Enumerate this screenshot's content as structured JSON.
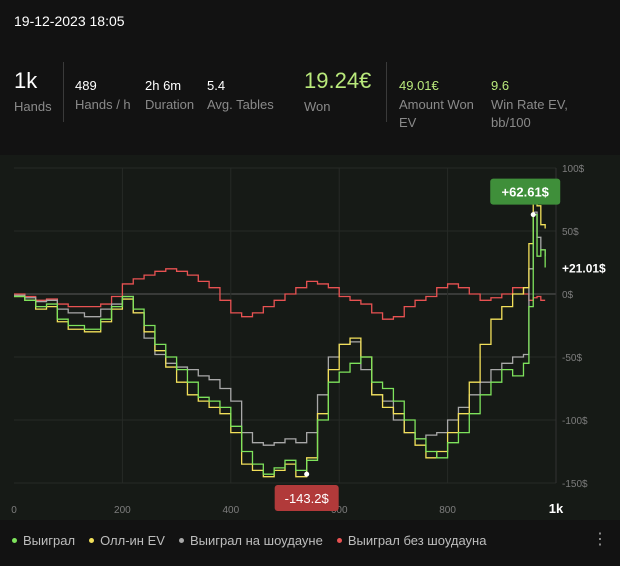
{
  "header": {
    "date": "19-12-2023 18:05"
  },
  "stats": {
    "hands": {
      "value": "1k",
      "label": "Hands"
    },
    "hands_per_hour": {
      "value": "489",
      "label": "Hands / h"
    },
    "duration": {
      "value": "2h 6m",
      "label": "Duration"
    },
    "avg_tables": {
      "value": "5.4",
      "label": "Avg. Tables"
    },
    "won": {
      "value": "19.24€",
      "label": "Won"
    },
    "amount_won_ev": {
      "value": "49.01€",
      "label": "Amount Won EV"
    },
    "win_rate_ev": {
      "value": "9.6",
      "label": "Win Rate EV, bb/100"
    }
  },
  "colors": {
    "won": "#7ee35c",
    "allin_ev": "#f2e05a",
    "showdown": "#a8a8a8",
    "non_showdown": "#e85252",
    "max_badge": "#3f8f3a",
    "min_badge": "#b13a3a"
  },
  "chart_data": {
    "type": "line",
    "x_tick_labels": [
      "0",
      "200",
      "400",
      "600",
      "800",
      "1k"
    ],
    "y_tick_labels": [
      "100$",
      "50$",
      "0$",
      "-50$",
      "-100$",
      "-150$"
    ],
    "xlim": [
      0,
      1000
    ],
    "ylim": [
      -150,
      100
    ],
    "max_label": "+62.61$",
    "min_label": "-143.2$",
    "current_label": "+21.01$",
    "series": [
      {
        "name": "Выиграл",
        "points": [
          [
            0,
            -2
          ],
          [
            20,
            -5
          ],
          [
            40,
            -10
          ],
          [
            60,
            -8
          ],
          [
            80,
            -20
          ],
          [
            100,
            -25
          ],
          [
            130,
            -28
          ],
          [
            160,
            -20
          ],
          [
            180,
            -10
          ],
          [
            200,
            -2
          ],
          [
            220,
            -12
          ],
          [
            240,
            -25
          ],
          [
            260,
            -40
          ],
          [
            280,
            -50
          ],
          [
            300,
            -60
          ],
          [
            320,
            -70
          ],
          [
            340,
            -82
          ],
          [
            360,
            -85
          ],
          [
            380,
            -90
          ],
          [
            400,
            -105
          ],
          [
            420,
            -125
          ],
          [
            440,
            -135
          ],
          [
            460,
            -143
          ],
          [
            480,
            -138
          ],
          [
            500,
            -132
          ],
          [
            520,
            -140
          ],
          [
            540,
            -132
          ],
          [
            560,
            -100
          ],
          [
            580,
            -70
          ],
          [
            600,
            -62
          ],
          [
            620,
            -55
          ],
          [
            640,
            -50
          ],
          [
            660,
            -70
          ],
          [
            680,
            -75
          ],
          [
            700,
            -85
          ],
          [
            720,
            -100
          ],
          [
            740,
            -115
          ],
          [
            760,
            -125
          ],
          [
            780,
            -130
          ],
          [
            800,
            -118
          ],
          [
            820,
            -110
          ],
          [
            840,
            -95
          ],
          [
            860,
            -80
          ],
          [
            880,
            -70
          ],
          [
            900,
            -60
          ],
          [
            920,
            -65
          ],
          [
            940,
            -55
          ],
          [
            950,
            -10
          ],
          [
            958,
            63
          ],
          [
            965,
            30
          ],
          [
            972,
            35
          ],
          [
            980,
            21
          ]
        ]
      },
      {
        "name": "Олл-ин EV",
        "points": [
          [
            0,
            -2
          ],
          [
            20,
            -5
          ],
          [
            40,
            -12
          ],
          [
            60,
            -10
          ],
          [
            80,
            -22
          ],
          [
            100,
            -28
          ],
          [
            130,
            -30
          ],
          [
            160,
            -22
          ],
          [
            180,
            -12
          ],
          [
            200,
            -4
          ],
          [
            220,
            -15
          ],
          [
            240,
            -30
          ],
          [
            260,
            -45
          ],
          [
            280,
            -58
          ],
          [
            300,
            -70
          ],
          [
            320,
            -80
          ],
          [
            340,
            -85
          ],
          [
            360,
            -90
          ],
          [
            380,
            -95
          ],
          [
            400,
            -110
          ],
          [
            420,
            -135
          ],
          [
            440,
            -140
          ],
          [
            460,
            -145
          ],
          [
            480,
            -140
          ],
          [
            500,
            -135
          ],
          [
            520,
            -145
          ],
          [
            540,
            -130
          ],
          [
            560,
            -95
          ],
          [
            580,
            -60
          ],
          [
            600,
            -40
          ],
          [
            620,
            -35
          ],
          [
            640,
            -50
          ],
          [
            660,
            -80
          ],
          [
            680,
            -90
          ],
          [
            700,
            -95
          ],
          [
            720,
            -110
          ],
          [
            740,
            -120
          ],
          [
            760,
            -130
          ],
          [
            780,
            -125
          ],
          [
            800,
            -110
          ],
          [
            820,
            -95
          ],
          [
            840,
            -70
          ],
          [
            860,
            -40
          ],
          [
            880,
            -20
          ],
          [
            900,
            -10
          ],
          [
            920,
            0
          ],
          [
            940,
            5
          ],
          [
            950,
            40
          ],
          [
            958,
            90
          ],
          [
            965,
            70
          ],
          [
            972,
            55
          ],
          [
            980,
            52
          ]
        ]
      },
      {
        "name": "Выиграл на шоудауне",
        "points": [
          [
            0,
            -1
          ],
          [
            20,
            -3
          ],
          [
            40,
            -6
          ],
          [
            60,
            -5
          ],
          [
            80,
            -12
          ],
          [
            100,
            -15
          ],
          [
            130,
            -18
          ],
          [
            160,
            -12
          ],
          [
            180,
            -8
          ],
          [
            200,
            -2
          ],
          [
            220,
            -15
          ],
          [
            240,
            -35
          ],
          [
            260,
            -48
          ],
          [
            280,
            -55
          ],
          [
            300,
            -58
          ],
          [
            320,
            -60
          ],
          [
            340,
            -65
          ],
          [
            360,
            -68
          ],
          [
            380,
            -75
          ],
          [
            400,
            -85
          ],
          [
            420,
            -110
          ],
          [
            440,
            -118
          ],
          [
            460,
            -120
          ],
          [
            480,
            -118
          ],
          [
            500,
            -115
          ],
          [
            520,
            -118
          ],
          [
            540,
            -110
          ],
          [
            560,
            -80
          ],
          [
            580,
            -50
          ],
          [
            600,
            -40
          ],
          [
            620,
            -38
          ],
          [
            640,
            -60
          ],
          [
            660,
            -80
          ],
          [
            680,
            -85
          ],
          [
            700,
            -100
          ],
          [
            720,
            -110
          ],
          [
            740,
            -115
          ],
          [
            760,
            -112
          ],
          [
            780,
            -110
          ],
          [
            800,
            -100
          ],
          [
            820,
            -90
          ],
          [
            840,
            -80
          ],
          [
            860,
            -70
          ],
          [
            880,
            -60
          ],
          [
            900,
            -55
          ],
          [
            920,
            -50
          ],
          [
            940,
            -48
          ],
          [
            950,
            20
          ],
          [
            958,
            65
          ],
          [
            965,
            45
          ],
          [
            972,
            35
          ],
          [
            980,
            30
          ]
        ]
      },
      {
        "name": "Выиграл без шоудауна",
        "points": [
          [
            0,
            0
          ],
          [
            20,
            -2
          ],
          [
            40,
            -5
          ],
          [
            60,
            -4
          ],
          [
            80,
            -8
          ],
          [
            100,
            -10
          ],
          [
            130,
            -10
          ],
          [
            160,
            -8
          ],
          [
            180,
            -2
          ],
          [
            200,
            8
          ],
          [
            220,
            12
          ],
          [
            240,
            15
          ],
          [
            260,
            18
          ],
          [
            280,
            20
          ],
          [
            300,
            18
          ],
          [
            320,
            15
          ],
          [
            340,
            10
          ],
          [
            360,
            5
          ],
          [
            380,
            -5
          ],
          [
            400,
            -15
          ],
          [
            420,
            -18
          ],
          [
            440,
            -15
          ],
          [
            460,
            -10
          ],
          [
            480,
            -5
          ],
          [
            500,
            0
          ],
          [
            520,
            5
          ],
          [
            540,
            10
          ],
          [
            560,
            8
          ],
          [
            580,
            5
          ],
          [
            600,
            -2
          ],
          [
            620,
            -5
          ],
          [
            640,
            -8
          ],
          [
            660,
            -15
          ],
          [
            680,
            -20
          ],
          [
            700,
            -18
          ],
          [
            720,
            -10
          ],
          [
            740,
            -5
          ],
          [
            760,
            -2
          ],
          [
            780,
            5
          ],
          [
            800,
            8
          ],
          [
            820,
            5
          ],
          [
            840,
            0
          ],
          [
            860,
            -5
          ],
          [
            880,
            -3
          ],
          [
            900,
            0
          ],
          [
            920,
            5
          ],
          [
            940,
            0
          ],
          [
            950,
            -5
          ],
          [
            958,
            -3
          ],
          [
            965,
            -2
          ],
          [
            972,
            -5
          ],
          [
            980,
            -5
          ]
        ]
      }
    ]
  },
  "legend": {
    "won": "Выиграл",
    "allin_ev": "Олл-ин EV",
    "showdown": "Выиграл на шоудауне",
    "non_showdown": "Выиграл без шоудауна"
  }
}
